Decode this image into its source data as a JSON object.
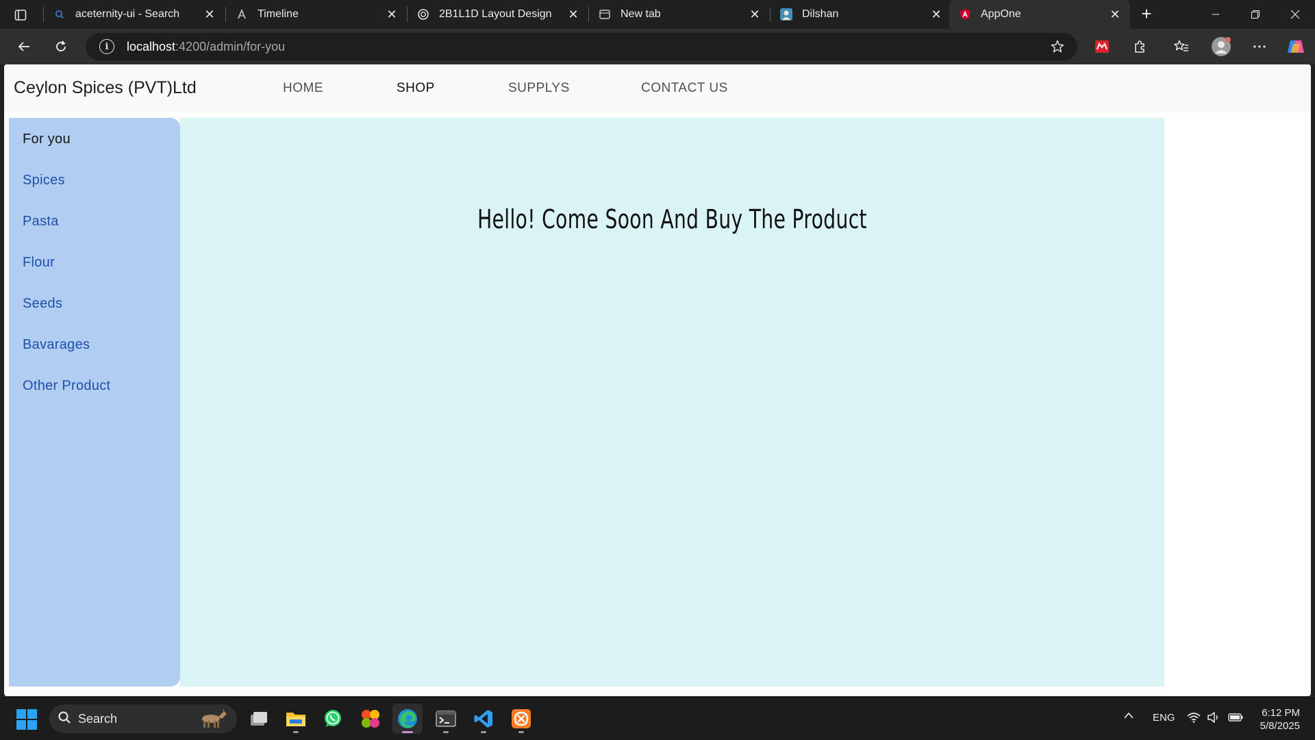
{
  "browser": {
    "tabs": [
      {
        "title": "aceternity-ui - Search",
        "icon": "search-favicon",
        "active": false
      },
      {
        "title": "Timeline",
        "icon": "aceternity-favicon",
        "active": false
      },
      {
        "title": "2B1L1D Layout Design",
        "icon": "openai-favicon",
        "active": false
      },
      {
        "title": "New tab",
        "icon": "newtab-favicon",
        "active": false
      },
      {
        "title": "Dilshan",
        "icon": "profile-favicon",
        "active": false
      },
      {
        "title": "AppOne",
        "icon": "angular-favicon",
        "active": true
      }
    ],
    "url": {
      "host": "localhost",
      "path": ":4200/admin/for-you"
    }
  },
  "page": {
    "brand": "Ceylon Spices (PVT)Ltd",
    "nav": [
      {
        "label": "HOME",
        "active": false
      },
      {
        "label": "SHOP",
        "active": true
      },
      {
        "label": "SUPPLYS",
        "active": false
      },
      {
        "label": "CONTACT US",
        "active": false
      }
    ],
    "sidebar": [
      {
        "label": "For you",
        "active": true
      },
      {
        "label": "Spices",
        "active": false
      },
      {
        "label": "Pasta",
        "active": false
      },
      {
        "label": "Flour",
        "active": false
      },
      {
        "label": "Seeds",
        "active": false
      },
      {
        "label": "Bavarages",
        "active": false
      },
      {
        "label": "Other Product",
        "active": false
      }
    ],
    "message": "Hello! Come Soon And Buy The Product",
    "colors": {
      "sidebar": "#b2cdf2",
      "content": "#daf3f4",
      "link": "#1f4fa8"
    }
  },
  "taskbar": {
    "search_label": "Search",
    "language": "ENG",
    "time": "6:12 PM",
    "date": "5/8/2025"
  }
}
